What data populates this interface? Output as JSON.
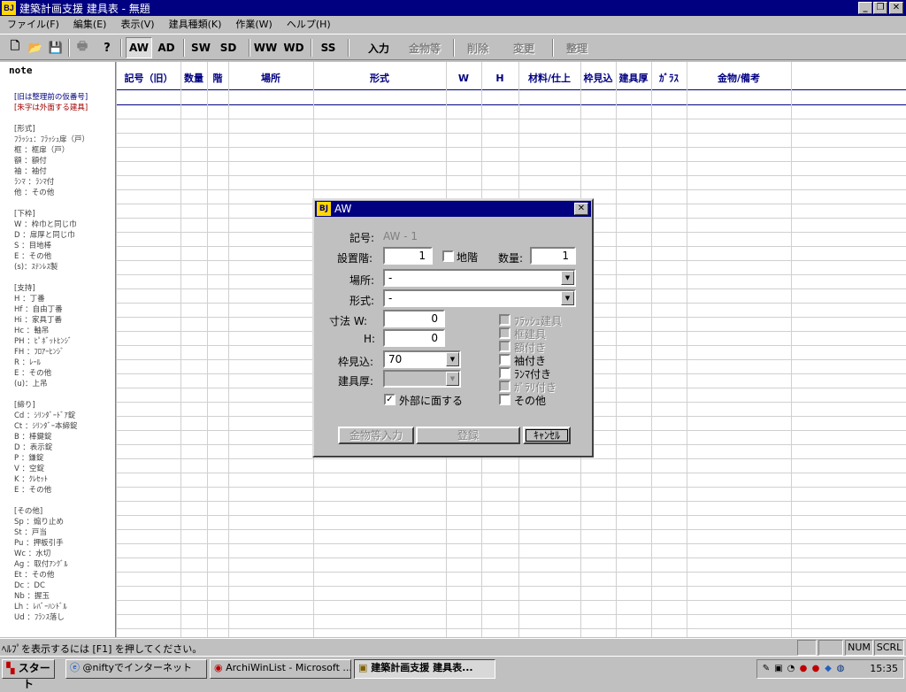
{
  "window": {
    "title": "建築計画支援  建具表 - 無題",
    "icon": "BJ"
  },
  "menu": [
    "ファイル(F)",
    "編集(E)",
    "表示(V)",
    "建具種類(K)",
    "作業(W)",
    "ヘルプ(H)"
  ],
  "toolbar": {
    "types": [
      "AW",
      "AD",
      "SW",
      "SD",
      "WW",
      "WD",
      "SS"
    ],
    "actions": [
      "入力",
      "金物等",
      "削除",
      "変更",
      "整理"
    ]
  },
  "note": {
    "title": "note",
    "lines": [
      {
        "t": "[旧は整理前の仮番号]",
        "c": "blue"
      },
      {
        "t": "[朱字は外面する建具]",
        "c": "red"
      },
      {
        "t": "",
        "c": ""
      },
      {
        "t": "[形式]",
        "c": ""
      },
      {
        "t": "ﾌﾗｯｼｭ：ﾌﾗｯｼｭ扉（戸）",
        "c": ""
      },
      {
        "t": "框  ：框扉（戸）",
        "c": ""
      },
      {
        "t": "額  ：額付",
        "c": ""
      },
      {
        "t": "袖  ：袖付",
        "c": ""
      },
      {
        "t": "ﾗﾝﾏ ：ﾗﾝﾏ付",
        "c": ""
      },
      {
        "t": "他  ：その他",
        "c": ""
      },
      {
        "t": "",
        "c": ""
      },
      {
        "t": "[下枠]",
        "c": ""
      },
      {
        "t": "W  ：枠巾と同じ巾",
        "c": ""
      },
      {
        "t": "D  ：扉厚と同じ巾",
        "c": ""
      },
      {
        "t": "S  ：目地棒",
        "c": ""
      },
      {
        "t": "E  ：その他",
        "c": ""
      },
      {
        "t": "(s)：ｽﾃﾝﾚｽ製",
        "c": ""
      },
      {
        "t": "",
        "c": ""
      },
      {
        "t": "[支持]",
        "c": ""
      },
      {
        "t": "H  ：丁番",
        "c": ""
      },
      {
        "t": "Hf ：自由丁番",
        "c": ""
      },
      {
        "t": "Hi ：家具丁番",
        "c": ""
      },
      {
        "t": "Hc ：軸吊",
        "c": ""
      },
      {
        "t": "PH ：ﾋﾟﾎﾞｯﾄﾋﾝｼﾞ",
        "c": ""
      },
      {
        "t": "FH ：ﾌﾛｱｰﾋﾝｼﾞ",
        "c": ""
      },
      {
        "t": "R  ：ﾚｰﾙ",
        "c": ""
      },
      {
        "t": "E  ：その他",
        "c": ""
      },
      {
        "t": "(u)：上吊",
        "c": ""
      },
      {
        "t": "",
        "c": ""
      },
      {
        "t": "[締り]",
        "c": ""
      },
      {
        "t": "Cd ：ｼﾘﾝﾀﾞｰﾄﾞｱ錠",
        "c": ""
      },
      {
        "t": "Ct ：ｼﾘﾝﾀﾞｰ本締錠",
        "c": ""
      },
      {
        "t": "B  ：棒鍵錠",
        "c": ""
      },
      {
        "t": "D  ：表示錠",
        "c": ""
      },
      {
        "t": "P  ：鎌錠",
        "c": ""
      },
      {
        "t": "V  ：空錠",
        "c": ""
      },
      {
        "t": "K  ：ｸﾚｾｯﾄ",
        "c": ""
      },
      {
        "t": "E  ：その他",
        "c": ""
      },
      {
        "t": "",
        "c": ""
      },
      {
        "t": "[その他]",
        "c": ""
      },
      {
        "t": "Sp ：煽り止め",
        "c": ""
      },
      {
        "t": "St ：戸当",
        "c": ""
      },
      {
        "t": "Pu ：押板引手",
        "c": ""
      },
      {
        "t": "Wc ：水切",
        "c": ""
      },
      {
        "t": "Ag ：取付ｱﾝｸﾞﾙ",
        "c": ""
      },
      {
        "t": "Et ：その他",
        "c": ""
      },
      {
        "t": "Dc ：DC",
        "c": ""
      },
      {
        "t": "Nb ：握玉",
        "c": ""
      },
      {
        "t": "Lh ：ﾚﾊﾞｰﾊﾝﾄﾞﾙ",
        "c": ""
      },
      {
        "t": "Ud ：ﾌﾗﾝｽ落し",
        "c": ""
      }
    ]
  },
  "grid": {
    "columns": [
      "記号（旧）",
      "数量",
      "階",
      "場所",
      "形式",
      "W",
      "H",
      "材料/仕上",
      "枠見込",
      "建具厚",
      "ｶﾞﾗｽ",
      "金物/備考"
    ]
  },
  "dialog": {
    "title": "AW",
    "icon": "BJ",
    "code_label": "記号:",
    "code_value": "AW -   1",
    "floor_label": "設置階:",
    "floor_value": "1",
    "basement_label": "地階",
    "qty_label": "数量:",
    "qty_value": "1",
    "place_label": "場所:",
    "place_value": "-",
    "type_label": "形式:",
    "type_value": "-",
    "dim_label": "寸法  W:",
    "w_value": "0",
    "h_label": "H:",
    "h_value": "0",
    "frame_label": "枠見込:",
    "frame_value": "70",
    "thickness_label": "建具厚:",
    "exterior_label": "外部に面する",
    "options": [
      {
        "label": "ﾌﾗｯｼｭ建具",
        "disabled": true
      },
      {
        "label": "框建具",
        "disabled": true
      },
      {
        "label": "額付き",
        "disabled": true
      },
      {
        "label": "袖付き",
        "disabled": false
      },
      {
        "label": "ﾗﾝﾏ付き",
        "disabled": false
      },
      {
        "label": "ｶﾞﾗﾘ付き",
        "disabled": true
      },
      {
        "label": "その他",
        "disabled": false
      }
    ],
    "btn_hardware": "金物等入力",
    "btn_register": "登録",
    "btn_cancel": "ｷｬﾝｾﾙ"
  },
  "status": {
    "text": "ﾍﾙﾌﾟを表示するには [F1] を押してください。",
    "num": "NUM",
    "scrl": "SCRL"
  },
  "taskbar": {
    "start": "スタート",
    "tasks": [
      "@niftyでインターネット",
      "ArchiWinList - Microsoft ...",
      "建築計画支援  建具表..."
    ],
    "clock": "15:35"
  },
  "colors": {
    "title": "#000080",
    "face": "#c0c0c0",
    "grid_header": "#000080",
    "note_red": "#a00000"
  }
}
